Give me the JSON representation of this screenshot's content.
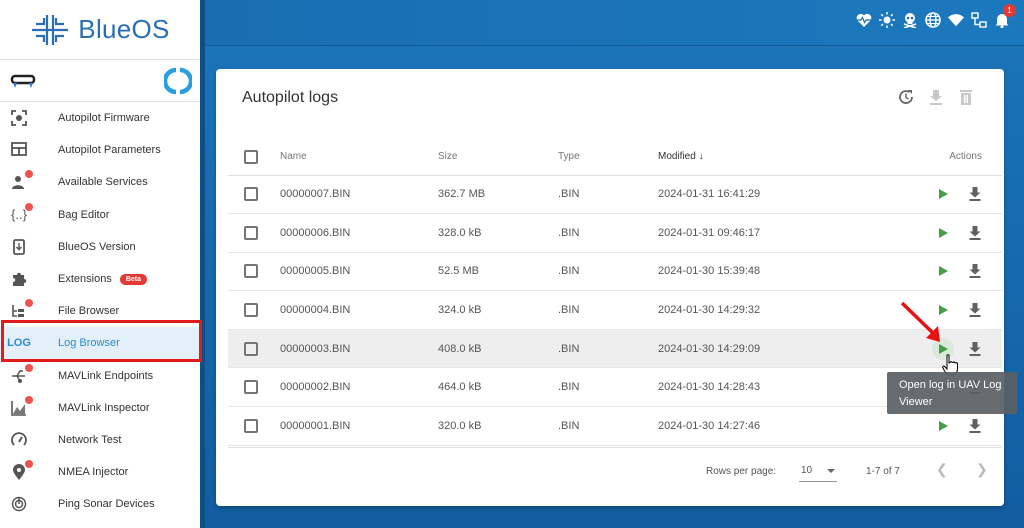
{
  "app": {
    "name": "BlueOS"
  },
  "sidebar": {
    "items": [
      {
        "label": "Autopilot Firmware",
        "icon": "firmware-icon",
        "badge": false
      },
      {
        "label": "Autopilot Parameters",
        "icon": "table-icon",
        "badge": false
      },
      {
        "label": "Available Services",
        "icon": "services-icon",
        "badge": true
      },
      {
        "label": "Bag Editor",
        "icon": "braces-icon",
        "badge": true
      },
      {
        "label": "BlueOS Version",
        "icon": "phone-download-icon",
        "badge": false
      },
      {
        "label": "Extensions",
        "icon": "puzzle-icon",
        "badge": false,
        "tag": "Beta"
      },
      {
        "label": "File Browser",
        "icon": "file-tree-icon",
        "badge": true
      },
      {
        "label": "Log Browser",
        "icon": "log-icon",
        "icon_text": "LOG",
        "badge": false,
        "active": true
      },
      {
        "label": "MAVLink Endpoints",
        "icon": "usb-icon",
        "badge": true
      },
      {
        "label": "MAVLink Inspector",
        "icon": "chart-area-icon",
        "badge": true
      },
      {
        "label": "Network Test",
        "icon": "speedometer-icon",
        "badge": false
      },
      {
        "label": "NMEA Injector",
        "icon": "map-marker-icon",
        "badge": true
      },
      {
        "label": "Ping Sonar Devices",
        "icon": "radar-icon",
        "badge": false
      }
    ]
  },
  "topbar": {
    "icons": [
      "heart-pulse-icon",
      "brightness-icon",
      "skull-icon",
      "globe-icon",
      "wifi-icon",
      "network-icon",
      "bell-icon"
    ],
    "notification_count": "1"
  },
  "card": {
    "title": "Autopilot logs",
    "tools": [
      "refresh-clock-icon",
      "download-icon",
      "delete-icon"
    ],
    "table": {
      "headers": {
        "name": "Name",
        "size": "Size",
        "type": "Type",
        "modified": "Modified",
        "actions": "Actions"
      },
      "sort_column": "Modified",
      "sort_direction": "descending",
      "rows": [
        {
          "name": "00000007.BIN",
          "size": "362.7 MB",
          "type": ".BIN",
          "modified": "2024-01-31 16:41:29"
        },
        {
          "name": "00000006.BIN",
          "size": "328.0 kB",
          "type": ".BIN",
          "modified": "2024-01-31 09:46:17"
        },
        {
          "name": "00000005.BIN",
          "size": "52.5 MB",
          "type": ".BIN",
          "modified": "2024-01-30 15:39:48"
        },
        {
          "name": "00000004.BIN",
          "size": "324.0 kB",
          "type": ".BIN",
          "modified": "2024-01-30 14:29:32"
        },
        {
          "name": "00000003.BIN",
          "size": "408.0 kB",
          "type": ".BIN",
          "modified": "2024-01-30 14:29:09",
          "hovered": true
        },
        {
          "name": "00000002.BIN",
          "size": "464.0 kB",
          "type": ".BIN",
          "modified": "2024-01-30 14:28:43"
        },
        {
          "name": "00000001.BIN",
          "size": "320.0 kB",
          "type": ".BIN",
          "modified": "2024-01-30 14:27:46"
        }
      ]
    },
    "footer": {
      "rows_per_page_label": "Rows per page:",
      "rows_per_page_value": "10",
      "range": "1-7 of 7"
    }
  },
  "tooltip": {
    "text": "Open log in UAV Log Viewer"
  },
  "colors": {
    "accent": "#2a8bd0",
    "play": "#43a047",
    "highlight": "#e01b1b",
    "topbar": "#1a6eb0"
  }
}
